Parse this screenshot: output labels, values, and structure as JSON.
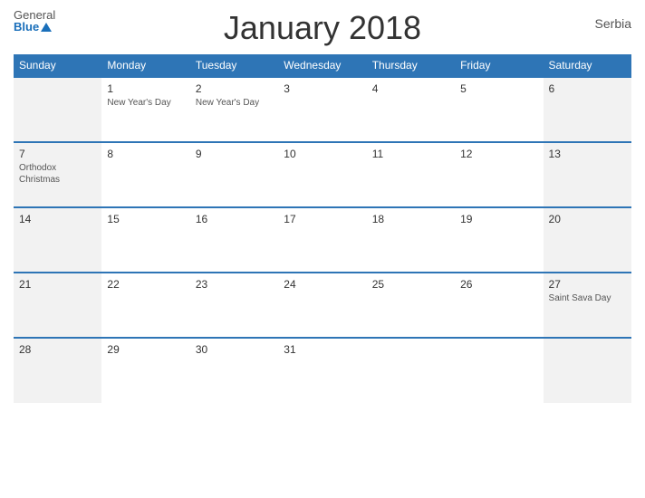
{
  "header": {
    "title": "January 2018",
    "country": "Serbia"
  },
  "logo": {
    "general": "General",
    "blue": "Blue"
  },
  "days_of_week": [
    "Sunday",
    "Monday",
    "Tuesday",
    "Wednesday",
    "Thursday",
    "Friday",
    "Saturday"
  ],
  "weeks": [
    [
      {
        "day": "",
        "holiday": ""
      },
      {
        "day": "1",
        "holiday": "New Year's Day"
      },
      {
        "day": "2",
        "holiday": "New Year's Day"
      },
      {
        "day": "3",
        "holiday": ""
      },
      {
        "day": "4",
        "holiday": ""
      },
      {
        "day": "5",
        "holiday": ""
      },
      {
        "day": "6",
        "holiday": ""
      }
    ],
    [
      {
        "day": "7",
        "holiday": "Orthodox Christmas"
      },
      {
        "day": "8",
        "holiday": ""
      },
      {
        "day": "9",
        "holiday": ""
      },
      {
        "day": "10",
        "holiday": ""
      },
      {
        "day": "11",
        "holiday": ""
      },
      {
        "day": "12",
        "holiday": ""
      },
      {
        "day": "13",
        "holiday": ""
      }
    ],
    [
      {
        "day": "14",
        "holiday": ""
      },
      {
        "day": "15",
        "holiday": ""
      },
      {
        "day": "16",
        "holiday": ""
      },
      {
        "day": "17",
        "holiday": ""
      },
      {
        "day": "18",
        "holiday": ""
      },
      {
        "day": "19",
        "holiday": ""
      },
      {
        "day": "20",
        "holiday": ""
      }
    ],
    [
      {
        "day": "21",
        "holiday": ""
      },
      {
        "day": "22",
        "holiday": ""
      },
      {
        "day": "23",
        "holiday": ""
      },
      {
        "day": "24",
        "holiday": ""
      },
      {
        "day": "25",
        "holiday": ""
      },
      {
        "day": "26",
        "holiday": ""
      },
      {
        "day": "27",
        "holiday": "Saint Sava Day"
      }
    ],
    [
      {
        "day": "28",
        "holiday": ""
      },
      {
        "day": "29",
        "holiday": ""
      },
      {
        "day": "30",
        "holiday": ""
      },
      {
        "day": "31",
        "holiday": ""
      },
      {
        "day": "",
        "holiday": ""
      },
      {
        "day": "",
        "holiday": ""
      },
      {
        "day": "",
        "holiday": ""
      }
    ]
  ],
  "colors": {
    "header_bg": "#2e75b6",
    "accent": "#1a6fba",
    "border": "#2e75b6",
    "sunday_bg": "#f2f2f2",
    "saturday_bg": "#f2f2f2"
  }
}
